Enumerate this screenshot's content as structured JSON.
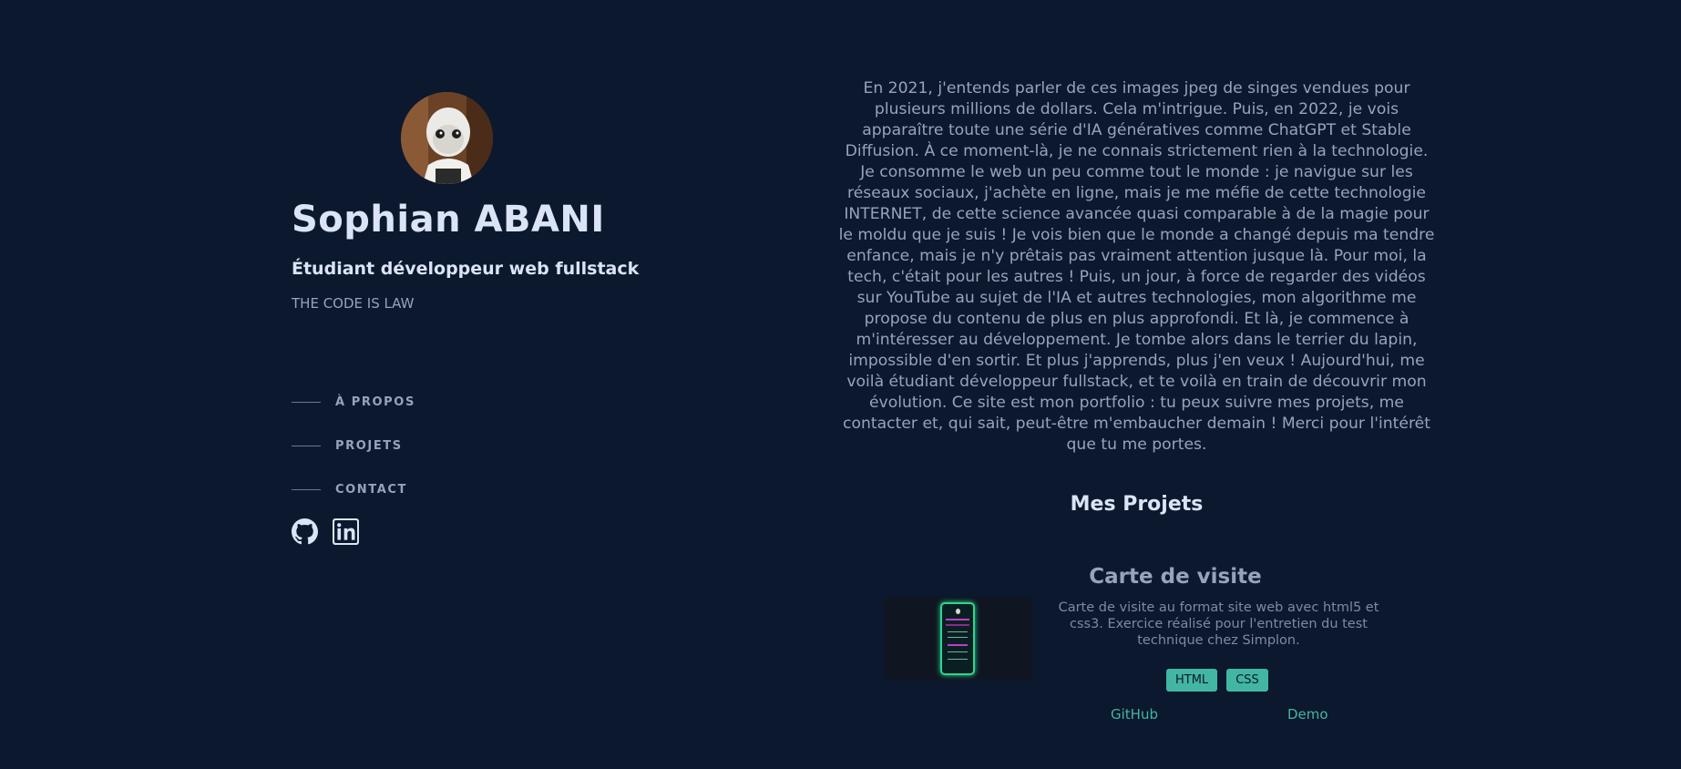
{
  "profile": {
    "name": "Sophian ABANI",
    "role": "Étudiant développeur web fullstack",
    "motto": "THE CODE IS LAW"
  },
  "nav": {
    "items": [
      {
        "label": "À PROPOS"
      },
      {
        "label": "PROJETS"
      },
      {
        "label": "CONTACT"
      }
    ]
  },
  "socials": {
    "items": [
      {
        "icon": "github-icon"
      },
      {
        "icon": "linkedin-icon"
      }
    ]
  },
  "about": {
    "text": "En 2021, j'entends parler de ces images jpeg de singes vendues pour plusieurs millions de dollars. Cela m'intrigue. Puis, en 2022, je vois apparaître toute une série d'IA génératives comme ChatGPT et Stable Diffusion. À ce moment-là, je ne connais strictement rien à la technologie. Je consomme le web un peu comme tout le monde : je navigue sur les réseaux sociaux, j'achète en ligne, mais je me méfie de cette technologie INTERNET, de cette science avancée quasi comparable à de la magie pour le moldu que je suis ! Je vois bien que le monde a changé depuis ma tendre enfance, mais je n'y prêtais pas vraiment attention jusque là. Pour moi, la tech, c'était pour les autres ! Puis, un jour, à force de regarder des vidéos sur YouTube au sujet de l'IA et autres technologies, mon algorithme me propose du contenu de plus en plus approfondi. Et là, je commence à m'intéresser au développement. Je tombe alors dans le terrier du lapin, impossible d'en sortir. Et plus j'apprends, plus j'en veux ! Aujourd'hui, me voilà étudiant développeur fullstack, et te voilà en train de découvrir mon évolution. Ce site est mon portfolio : tu peux suivre mes projets, me contacter et, qui sait, peut-être m'embaucher demain ! Merci pour l'intérêt que tu me portes."
  },
  "projects": {
    "title": "Mes Projets",
    "items": [
      {
        "title": "Carte de visite",
        "description": "Carte de visite au format site web avec html5 et css3. Exercice réalisé pour l'entretien du test technique chez Simplon.",
        "tags": [
          "HTML",
          "CSS"
        ],
        "github_label": "GitHub",
        "demo_label": "Demo"
      }
    ]
  },
  "colors": {
    "background": "#0c182e",
    "heading": "#dbe4f7",
    "muted": "#97a3b8",
    "accent": "#43b6a3"
  }
}
